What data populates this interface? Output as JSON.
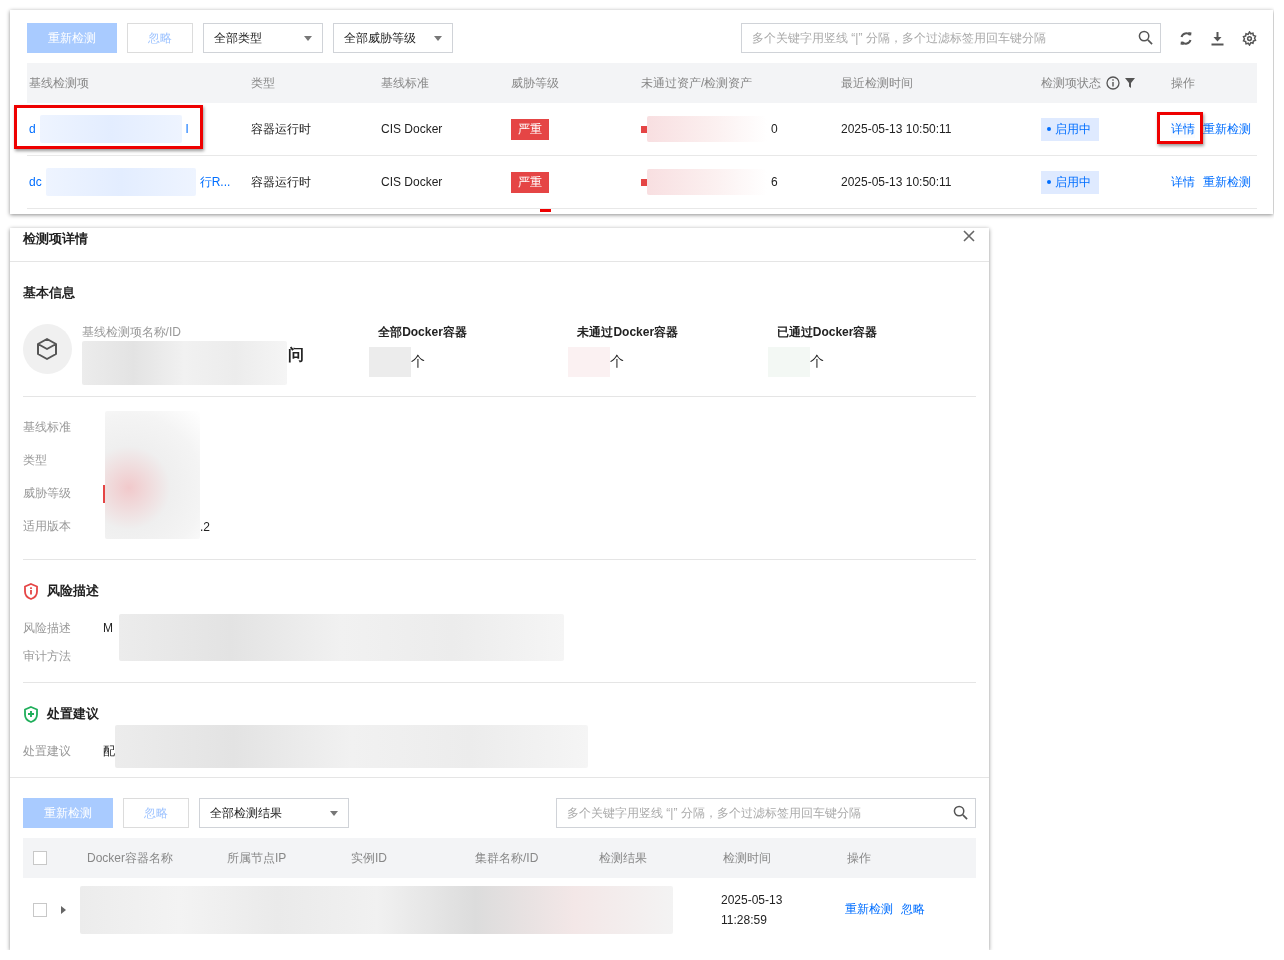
{
  "toolbar": {
    "buttons": [
      {
        "label": "重新检测",
        "kind": "primary",
        "disabled": true
      },
      {
        "label": "忽略",
        "kind": "default",
        "disabled": true
      }
    ],
    "filters": [
      "全部类型",
      "全部威胁等级"
    ],
    "search": {
      "placeholder": "多个关键字用竖线 “|” 分隔，多个过滤标签用回车键分隔"
    }
  },
  "table": {
    "columns": [
      "基线检测项",
      "类型",
      "基线标准",
      "威胁等级",
      "未通过资产/检测资产",
      "最近检测时间",
      "检测项状态",
      "操作"
    ],
    "rows": [
      {
        "name_start": "d",
        "name_end": "l",
        "highlighted": true,
        "type": "容器运行时",
        "standard": "CIS Docker",
        "severity": "严重",
        "level": 0.08,
        "count": "0",
        "time": "2025-05-13 10:50:11",
        "status": "启用中",
        "actions": [
          {
            "label": "详情",
            "highlighted": true
          },
          {
            "label": "重新检测",
            "highlighted": false
          }
        ]
      },
      {
        "name_start": "dc",
        "name_end": "行R...",
        "highlighted": false,
        "type": "容器运行时",
        "standard": "CIS Docker",
        "severity": "严重",
        "level": 0.17,
        "count": "6",
        "time": "2025-05-13 10:50:11",
        "status": "启用中",
        "actions": [
          {
            "label": "详情",
            "highlighted": false
          },
          {
            "label": "重新检测",
            "highlighted": false
          }
        ]
      }
    ]
  },
  "detail": {
    "title": "检测项详情",
    "basic_title": "基本信息",
    "name_label": "基线检测项名称/ID",
    "name_end": "问",
    "stats": [
      {
        "label": "全部Docker容器",
        "unit": "个",
        "color": "#ececec"
      },
      {
        "label": "未通过Docker容器",
        "unit": "个",
        "color": "#fbf1f2"
      },
      {
        "label": "已通过Docker容器",
        "unit": "个",
        "color": "#f3f8f4"
      }
    ],
    "fields": [
      {
        "label": "基线标准",
        "kind": "text"
      },
      {
        "label": "类型",
        "kind": "text"
      },
      {
        "label": "威胁等级",
        "kind": "severity"
      },
      {
        "label": "适用版本",
        "kind": "text",
        "value_end": ".2"
      }
    ],
    "sections": [
      {
        "title": "风险描述",
        "kind": "risk",
        "fields": [
          {
            "label": "风险描述",
            "value_start": "M"
          },
          {
            "label": "审计方法"
          }
        ]
      },
      {
        "title": "处置建议",
        "kind": "fix",
        "fields": [
          {
            "label": "处置建议",
            "value_start": "配"
          }
        ]
      }
    ],
    "bottom": {
      "buttons": [
        {
          "label": "重新检测",
          "kind": "primary",
          "disabled": true
        },
        {
          "label": "忽略",
          "kind": "default",
          "disabled": true
        }
      ],
      "filter": "全部检测结果",
      "search": {
        "placeholder": "多个关键字用竖线 “|” 分隔，多个过滤标签用回车键分隔"
      },
      "columns": [
        "Docker容器名称",
        "所属节点IP",
        "实例ID",
        "集群名称/ID",
        "检测结果",
        "检测时间",
        "操作"
      ],
      "select_all_checked": false,
      "rows": [
        {
          "checked": false,
          "time_date": "2025-05-13",
          "time_clock": "11:28:59",
          "actions": [
            "重新检测",
            "忽略"
          ]
        }
      ]
    }
  }
}
